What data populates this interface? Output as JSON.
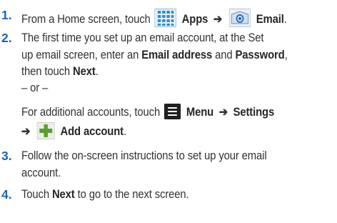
{
  "steps": [
    {
      "number": "1.",
      "line1": {
        "pre": "From a Home screen, touch",
        "apps": "Apps",
        "arrow": "➔",
        "email": "Email",
        "end": "."
      }
    },
    {
      "number": "2.",
      "line1": "The first time you set up an email account, at the Set",
      "line2": {
        "pre": "up email screen, enter an",
        "b1": "Email address",
        "mid": "and",
        "b2": "Password",
        "end": ","
      },
      "line3": {
        "pre": "then touch",
        "b": "Next",
        "end": "."
      },
      "or": "– or –",
      "line5": {
        "pre": "For additional accounts, touch",
        "menu": "Menu",
        "arrow": "➔",
        "settings": "Settings"
      },
      "line6": {
        "arrow": "➔",
        "add": "Add account",
        "end": "."
      }
    },
    {
      "number": "3.",
      "line1": "Follow the on-screen instructions to set up your email",
      "line2": "account."
    },
    {
      "number": "4.",
      "line1": {
        "pre": "Touch",
        "b": "Next",
        "post": "to go to the next screen."
      }
    }
  ],
  "icons": {
    "apps": "apps-grid-icon",
    "email": "email-envelope-icon",
    "menu": "menu-icon",
    "add": "add-plus-icon"
  },
  "colors": {
    "number": "#1a63b5",
    "text": "#333333",
    "apps_icon": "#2e8fd0",
    "plus": "#5aa02c"
  }
}
